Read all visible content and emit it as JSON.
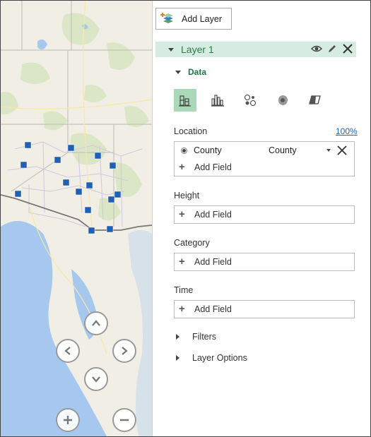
{
  "toolbar": {
    "add_layer_label": "Add Layer",
    "add_layer_icon": "add-layer-icon"
  },
  "layer": {
    "name": "Layer 1",
    "icons": [
      "eye-icon",
      "pencil-icon",
      "close-icon"
    ]
  },
  "data_section": {
    "label": "Data",
    "viz_types": [
      {
        "name": "stacked-column-icon",
        "active": true
      },
      {
        "name": "clustered-column-icon",
        "active": false
      },
      {
        "name": "bubble-icon",
        "active": false
      },
      {
        "name": "heat-map-icon",
        "active": false
      },
      {
        "name": "region-icon",
        "active": false
      }
    ]
  },
  "location": {
    "label": "Location",
    "percent": "100%",
    "field_name": "County",
    "field_type": "County",
    "add_field": "Add Field"
  },
  "height": {
    "label": "Height",
    "add_field": "Add Field"
  },
  "category": {
    "label": "Category",
    "add_field": "Add Field"
  },
  "time": {
    "label": "Time",
    "add_field": "Add Field"
  },
  "filters": {
    "label": "Filters"
  },
  "layer_options": {
    "label": "Layer Options"
  },
  "map_controls": [
    "tilt-up-icon",
    "rotate-left-icon",
    "rotate-right-icon",
    "tilt-down-icon",
    "zoom-in-icon",
    "zoom-out-icon"
  ],
  "colors": {
    "accent": "#2c7c4d",
    "layer_bg": "#d5ece0",
    "viz_active": "#a9d9b8",
    "link": "#1a66c6",
    "marker": "#1f5fb5",
    "water": "#a6c8ee"
  }
}
